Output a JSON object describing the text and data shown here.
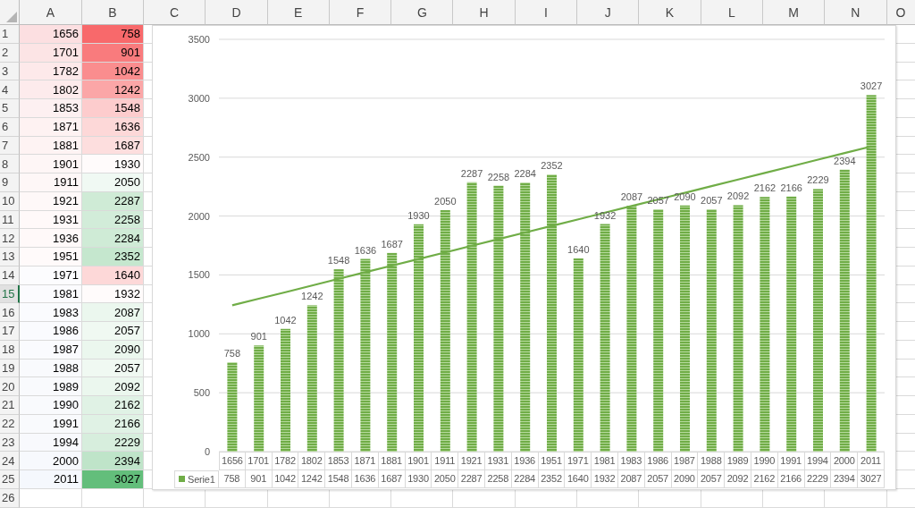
{
  "sheet": {
    "columns": [
      "A",
      "B",
      "C",
      "D",
      "E",
      "F",
      "G",
      "H",
      "I",
      "J",
      "K",
      "L",
      "M",
      "N",
      "O"
    ],
    "rows": [
      {
        "header": "1",
        "selected": false,
        "a": {
          "text": "1656",
          "color": "#fcdfe1"
        },
        "b": {
          "text": "758",
          "color": "#f8696b"
        }
      },
      {
        "header": "2",
        "selected": false,
        "a": {
          "text": "1701",
          "color": "#fce4e5"
        },
        "b": {
          "text": "901",
          "color": "#f97b7d"
        }
      },
      {
        "header": "3",
        "selected": false,
        "a": {
          "text": "1782",
          "color": "#fde9ea"
        },
        "b": {
          "text": "1042",
          "color": "#fa8d8e"
        }
      },
      {
        "header": "4",
        "selected": false,
        "a": {
          "text": "1802",
          "color": "#fdebec"
        },
        "b": {
          "text": "1242",
          "color": "#fba6a7"
        }
      },
      {
        "header": "5",
        "selected": false,
        "a": {
          "text": "1853",
          "color": "#fdf0f1"
        },
        "b": {
          "text": "1548",
          "color": "#fdcccd"
        }
      },
      {
        "header": "6",
        "selected": false,
        "a": {
          "text": "1871",
          "color": "#fef2f2"
        },
        "b": {
          "text": "1636",
          "color": "#fdd8d8"
        }
      },
      {
        "header": "7",
        "selected": false,
        "a": {
          "text": "1881",
          "color": "#fef3f3"
        },
        "b": {
          "text": "1687",
          "color": "#fddede"
        }
      },
      {
        "header": "8",
        "selected": false,
        "a": {
          "text": "1901",
          "color": "#fef6f6"
        },
        "b": {
          "text": "1930",
          "color": "#fffbfb"
        }
      },
      {
        "header": "9",
        "selected": false,
        "a": {
          "text": "1911",
          "color": "#fef7f7"
        },
        "b": {
          "text": "2050",
          "color": "#f0f9f3"
        }
      },
      {
        "header": "10",
        "selected": false,
        "a": {
          "text": "1921",
          "color": "#fef8f8"
        },
        "b": {
          "text": "2287",
          "color": "#cfebd6"
        }
      },
      {
        "header": "11",
        "selected": false,
        "a": {
          "text": "1931",
          "color": "#fff9f9"
        },
        "b": {
          "text": "2258",
          "color": "#d2ecd9"
        }
      },
      {
        "header": "12",
        "selected": false,
        "a": {
          "text": "1936",
          "color": "#fff9f9"
        },
        "b": {
          "text": "2284",
          "color": "#cfebd6"
        }
      },
      {
        "header": "13",
        "selected": false,
        "a": {
          "text": "1951",
          "color": "#fffafa"
        },
        "b": {
          "text": "2352",
          "color": "#c5e7ce"
        }
      },
      {
        "header": "14",
        "selected": false,
        "a": {
          "text": "1971",
          "color": "#fcfcfe"
        },
        "b": {
          "text": "1640",
          "color": "#fdd8d8"
        }
      },
      {
        "header": "15",
        "selected": true,
        "a": {
          "text": "1981",
          "color": "#fbfbfe"
        },
        "b": {
          "text": "1932",
          "color": "#fffbfb"
        }
      },
      {
        "header": "16",
        "selected": false,
        "a": {
          "text": "1983",
          "color": "#fafbfe"
        },
        "b": {
          "text": "2087",
          "color": "#ebf7ee"
        }
      },
      {
        "header": "17",
        "selected": false,
        "a": {
          "text": "1986",
          "color": "#fafbfe"
        },
        "b": {
          "text": "2057",
          "color": "#f0f9f2"
        }
      },
      {
        "header": "18",
        "selected": false,
        "a": {
          "text": "1987",
          "color": "#fafbfe"
        },
        "b": {
          "text": "2090",
          "color": "#ebf7ee"
        }
      },
      {
        "header": "19",
        "selected": false,
        "a": {
          "text": "1988",
          "color": "#f9fafd"
        },
        "b": {
          "text": "2057",
          "color": "#f0f9f2"
        }
      },
      {
        "header": "20",
        "selected": false,
        "a": {
          "text": "1989",
          "color": "#f9fafd"
        },
        "b": {
          "text": "2092",
          "color": "#ebf7ee"
        }
      },
      {
        "header": "21",
        "selected": false,
        "a": {
          "text": "1990",
          "color": "#f9fafd"
        },
        "b": {
          "text": "2162",
          "color": "#e0f2e5"
        }
      },
      {
        "header": "22",
        "selected": false,
        "a": {
          "text": "1991",
          "color": "#f9fafd"
        },
        "b": {
          "text": "2166",
          "color": "#e0f2e5"
        }
      },
      {
        "header": "23",
        "selected": false,
        "a": {
          "text": "1994",
          "color": "#f8f9fd"
        },
        "b": {
          "text": "2229",
          "color": "#d7eedd"
        }
      },
      {
        "header": "24",
        "selected": false,
        "a": {
          "text": "2000",
          "color": "#f7f9fd"
        },
        "b": {
          "text": "2394",
          "color": "#bfe4c9"
        }
      },
      {
        "header": "25",
        "selected": false,
        "a": {
          "text": "2011",
          "color": "#f5f8fd"
        },
        "b": {
          "text": "3027",
          "color": "#63be7b"
        }
      },
      {
        "header": "26",
        "selected": false
      }
    ]
  },
  "chart": {
    "chart_data": {
      "type": "bar",
      "categories": [
        "1656",
        "1701",
        "1782",
        "1802",
        "1853",
        "1871",
        "1881",
        "1901",
        "1911",
        "1921",
        "1931",
        "1936",
        "1951",
        "1971",
        "1981",
        "1983",
        "1986",
        "1987",
        "1988",
        "1989",
        "1990",
        "1991",
        "1994",
        "2000",
        "2011"
      ],
      "series": [
        {
          "name": "Serie1",
          "color": "#70ad47",
          "values": [
            758,
            901,
            1042,
            1242,
            1548,
            1636,
            1687,
            1930,
            2050,
            2287,
            2258,
            2284,
            2352,
            1640,
            1932,
            2087,
            2057,
            2090,
            2057,
            2092,
            2162,
            2166,
            2229,
            2394,
            3027
          ]
        },
        {
          "type": "line",
          "color": "#70ad47",
          "values": [
            1242,
            1298,
            1354,
            1410,
            1467,
            1523,
            1579,
            1635,
            1691,
            1748,
            1804,
            1860,
            1916,
            1972,
            2029,
            2085,
            2141,
            2197,
            2254,
            2310,
            2366,
            2422,
            2479,
            2535,
            2591
          ]
        }
      ],
      "ylim": [
        0,
        3500
      ],
      "yticks": [
        0,
        500,
        1000,
        1500,
        2000,
        2500,
        3000,
        3500
      ],
      "grid": true,
      "value_labels": [
        "758",
        "901",
        "1042",
        "1242",
        "1548",
        "1636",
        "1687",
        "1930",
        "2050",
        "2287",
        "2258",
        "2284",
        "2352",
        "1640",
        "1932",
        "2087",
        "2057",
        "2090",
        "2057",
        "2092",
        "2162",
        "2166",
        "2229",
        "2394",
        "3027"
      ]
    },
    "data_table": {
      "values": [
        "758",
        "901",
        "1042",
        "1242",
        "1548",
        "1636",
        "1687",
        "1930",
        "2050",
        "2287",
        "2258",
        "2284",
        "2352",
        "1640",
        "1932",
        "2087",
        "2057",
        "2090",
        "2057",
        "2092",
        "2162",
        "2166",
        "2229",
        "2394",
        "3027"
      ]
    }
  }
}
